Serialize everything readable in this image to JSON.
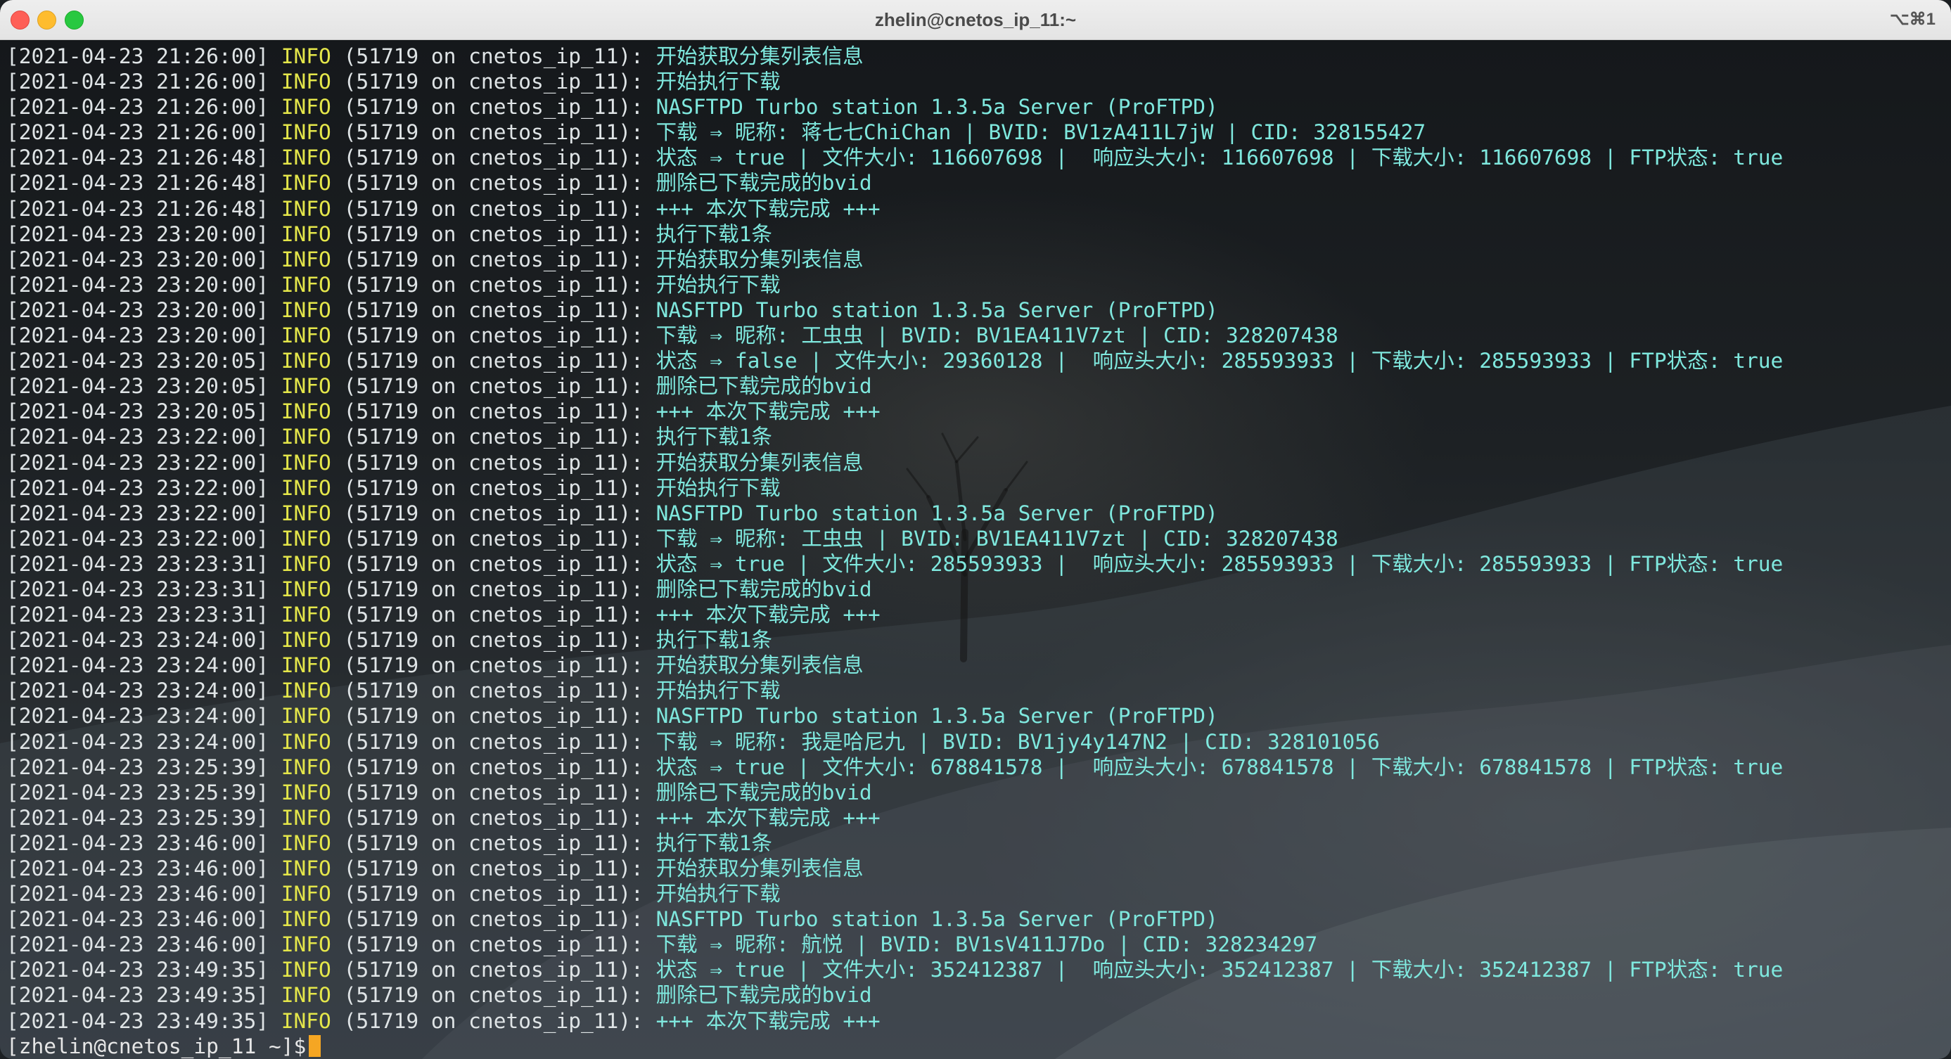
{
  "window": {
    "title": "zhelin@cnetos_ip_11:~",
    "shortcut": "⌥⌘1"
  },
  "log": [
    {
      "ts": "[2021-04-23 21:26:00]",
      "level": "INFO",
      "src": "(51719 on cnetos_ip_11):",
      "msg": "开始获取分集列表信息"
    },
    {
      "ts": "[2021-04-23 21:26:00]",
      "level": "INFO",
      "src": "(51719 on cnetos_ip_11):",
      "msg": "开始执行下载"
    },
    {
      "ts": "[2021-04-23 21:26:00]",
      "level": "INFO",
      "src": "(51719 on cnetos_ip_11):",
      "msg": "NASFTPD Turbo station 1.3.5a Server (ProFTPD)"
    },
    {
      "ts": "[2021-04-23 21:26:00]",
      "level": "INFO",
      "src": "(51719 on cnetos_ip_11):",
      "msg": "下载 ⇒ 昵称: 蒋七七ChiChan | BVID: BV1zA411L7jW | CID: 328155427"
    },
    {
      "ts": "[2021-04-23 21:26:48]",
      "level": "INFO",
      "src": "(51719 on cnetos_ip_11):",
      "msg": "状态 ⇒ true | 文件大小: 116607698 |  响应头大小: 116607698 | 下载大小: 116607698 | FTP状态: true"
    },
    {
      "ts": "[2021-04-23 21:26:48]",
      "level": "INFO",
      "src": "(51719 on cnetos_ip_11):",
      "msg": "删除已下载完成的bvid"
    },
    {
      "ts": "[2021-04-23 21:26:48]",
      "level": "INFO",
      "src": "(51719 on cnetos_ip_11):",
      "msg": "+++ 本次下载完成 +++"
    },
    {
      "ts": "[2021-04-23 23:20:00]",
      "level": "INFO",
      "src": "(51719 on cnetos_ip_11):",
      "msg": "执行下载1条"
    },
    {
      "ts": "[2021-04-23 23:20:00]",
      "level": "INFO",
      "src": "(51719 on cnetos_ip_11):",
      "msg": "开始获取分集列表信息"
    },
    {
      "ts": "[2021-04-23 23:20:00]",
      "level": "INFO",
      "src": "(51719 on cnetos_ip_11):",
      "msg": "开始执行下载"
    },
    {
      "ts": "[2021-04-23 23:20:00]",
      "level": "INFO",
      "src": "(51719 on cnetos_ip_11):",
      "msg": "NASFTPD Turbo station 1.3.5a Server (ProFTPD)"
    },
    {
      "ts": "[2021-04-23 23:20:00]",
      "level": "INFO",
      "src": "(51719 on cnetos_ip_11):",
      "msg": "下载 ⇒ 昵称: 工虫虫 | BVID: BV1EA411V7zt | CID: 328207438"
    },
    {
      "ts": "[2021-04-23 23:20:05]",
      "level": "INFO",
      "src": "(51719 on cnetos_ip_11):",
      "msg": "状态 ⇒ false | 文件大小: 29360128 |  响应头大小: 285593933 | 下载大小: 285593933 | FTP状态: true"
    },
    {
      "ts": "[2021-04-23 23:20:05]",
      "level": "INFO",
      "src": "(51719 on cnetos_ip_11):",
      "msg": "删除已下载完成的bvid"
    },
    {
      "ts": "[2021-04-23 23:20:05]",
      "level": "INFO",
      "src": "(51719 on cnetos_ip_11):",
      "msg": "+++ 本次下载完成 +++"
    },
    {
      "ts": "[2021-04-23 23:22:00]",
      "level": "INFO",
      "src": "(51719 on cnetos_ip_11):",
      "msg": "执行下载1条"
    },
    {
      "ts": "[2021-04-23 23:22:00]",
      "level": "INFO",
      "src": "(51719 on cnetos_ip_11):",
      "msg": "开始获取分集列表信息"
    },
    {
      "ts": "[2021-04-23 23:22:00]",
      "level": "INFO",
      "src": "(51719 on cnetos_ip_11):",
      "msg": "开始执行下载"
    },
    {
      "ts": "[2021-04-23 23:22:00]",
      "level": "INFO",
      "src": "(51719 on cnetos_ip_11):",
      "msg": "NASFTPD Turbo station 1.3.5a Server (ProFTPD)"
    },
    {
      "ts": "[2021-04-23 23:22:00]",
      "level": "INFO",
      "src": "(51719 on cnetos_ip_11):",
      "msg": "下载 ⇒ 昵称: 工虫虫 | BVID: BV1EA411V7zt | CID: 328207438"
    },
    {
      "ts": "[2021-04-23 23:23:31]",
      "level": "INFO",
      "src": "(51719 on cnetos_ip_11):",
      "msg": "状态 ⇒ true | 文件大小: 285593933 |  响应头大小: 285593933 | 下载大小: 285593933 | FTP状态: true"
    },
    {
      "ts": "[2021-04-23 23:23:31]",
      "level": "INFO",
      "src": "(51719 on cnetos_ip_11):",
      "msg": "删除已下载完成的bvid"
    },
    {
      "ts": "[2021-04-23 23:23:31]",
      "level": "INFO",
      "src": "(51719 on cnetos_ip_11):",
      "msg": "+++ 本次下载完成 +++"
    },
    {
      "ts": "[2021-04-23 23:24:00]",
      "level": "INFO",
      "src": "(51719 on cnetos_ip_11):",
      "msg": "执行下载1条"
    },
    {
      "ts": "[2021-04-23 23:24:00]",
      "level": "INFO",
      "src": "(51719 on cnetos_ip_11):",
      "msg": "开始获取分集列表信息"
    },
    {
      "ts": "[2021-04-23 23:24:00]",
      "level": "INFO",
      "src": "(51719 on cnetos_ip_11):",
      "msg": "开始执行下载"
    },
    {
      "ts": "[2021-04-23 23:24:00]",
      "level": "INFO",
      "src": "(51719 on cnetos_ip_11):",
      "msg": "NASFTPD Turbo station 1.3.5a Server (ProFTPD)"
    },
    {
      "ts": "[2021-04-23 23:24:00]",
      "level": "INFO",
      "src": "(51719 on cnetos_ip_11):",
      "msg": "下载 ⇒ 昵称: 我是哈尼九 | BVID: BV1jy4y147N2 | CID: 328101056"
    },
    {
      "ts": "[2021-04-23 23:25:39]",
      "level": "INFO",
      "src": "(51719 on cnetos_ip_11):",
      "msg": "状态 ⇒ true | 文件大小: 678841578 |  响应头大小: 678841578 | 下载大小: 678841578 | FTP状态: true"
    },
    {
      "ts": "[2021-04-23 23:25:39]",
      "level": "INFO",
      "src": "(51719 on cnetos_ip_11):",
      "msg": "删除已下载完成的bvid"
    },
    {
      "ts": "[2021-04-23 23:25:39]",
      "level": "INFO",
      "src": "(51719 on cnetos_ip_11):",
      "msg": "+++ 本次下载完成 +++"
    },
    {
      "ts": "[2021-04-23 23:46:00]",
      "level": "INFO",
      "src": "(51719 on cnetos_ip_11):",
      "msg": "执行下载1条"
    },
    {
      "ts": "[2021-04-23 23:46:00]",
      "level": "INFO",
      "src": "(51719 on cnetos_ip_11):",
      "msg": "开始获取分集列表信息"
    },
    {
      "ts": "[2021-04-23 23:46:00]",
      "level": "INFO",
      "src": "(51719 on cnetos_ip_11):",
      "msg": "开始执行下载"
    },
    {
      "ts": "[2021-04-23 23:46:00]",
      "level": "INFO",
      "src": "(51719 on cnetos_ip_11):",
      "msg": "NASFTPD Turbo station 1.3.5a Server (ProFTPD)"
    },
    {
      "ts": "[2021-04-23 23:46:00]",
      "level": "INFO",
      "src": "(51719 on cnetos_ip_11):",
      "msg": "下载 ⇒ 昵称: 航悦 | BVID: BV1sV411J7Do | CID: 328234297"
    },
    {
      "ts": "[2021-04-23 23:49:35]",
      "level": "INFO",
      "src": "(51719 on cnetos_ip_11):",
      "msg": "状态 ⇒ true | 文件大小: 352412387 |  响应头大小: 352412387 | 下载大小: 352412387 | FTP状态: true"
    },
    {
      "ts": "[2021-04-23 23:49:35]",
      "level": "INFO",
      "src": "(51719 on cnetos_ip_11):",
      "msg": "删除已下载完成的bvid"
    },
    {
      "ts": "[2021-04-23 23:49:35]",
      "level": "INFO",
      "src": "(51719 on cnetos_ip_11):",
      "msg": "+++ 本次下载完成 +++"
    }
  ],
  "prompt": "[zhelin@cnetos_ip_11 ~]$",
  "colors": {
    "timestamp": "#dfe4e6",
    "level": "#e4e64a",
    "message": "#7fe8de",
    "cursor": "#f5a623"
  }
}
